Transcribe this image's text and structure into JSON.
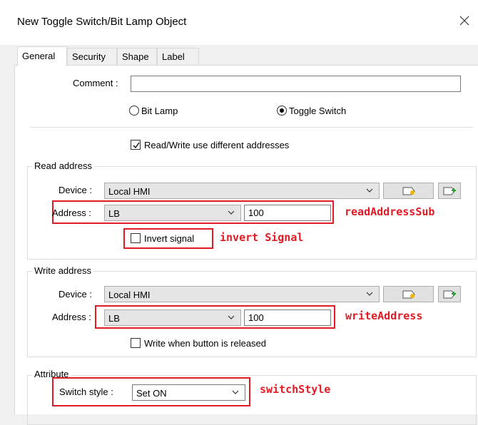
{
  "window": {
    "title": "New Toggle Switch/Bit Lamp Object"
  },
  "tabs": [
    "General",
    "Security",
    "Shape",
    "Label"
  ],
  "general": {
    "comment_label": "Comment :",
    "comment_value": "",
    "radio_bit_lamp": "Bit Lamp",
    "radio_toggle_switch": "Toggle Switch",
    "selected_mode": "Toggle Switch",
    "rw_diff_label": "Read/Write use different addresses",
    "rw_diff_checked": true
  },
  "read_address": {
    "group_title": "Read address",
    "device_label": "Device :",
    "device_value": "Local HMI",
    "address_label": "Address :",
    "address_type": "LB",
    "address_value": "100",
    "invert_label": "Invert signal",
    "invert_checked": false
  },
  "write_address": {
    "group_title": "Write address",
    "device_label": "Device :",
    "device_value": "Local HMI",
    "address_label": "Address :",
    "address_type": "LB",
    "address_value": "100",
    "release_label": "Write when button is released",
    "release_checked": false
  },
  "attribute": {
    "group_title": "Attribute",
    "switch_style_label": "Switch style :",
    "switch_style_value": "Set ON"
  },
  "annotations": {
    "read_address": "readAddressSub",
    "invert": "invert Signal",
    "write_address": "writeAddress",
    "switch_style": "switchStyle",
    "color": "#e01b24"
  },
  "icons": {
    "device_settings": "tag-settings-icon",
    "add_device": "add-tag-icon",
    "close": "close-icon",
    "dropdown": "chevron-down-icon",
    "check": "check-icon"
  }
}
